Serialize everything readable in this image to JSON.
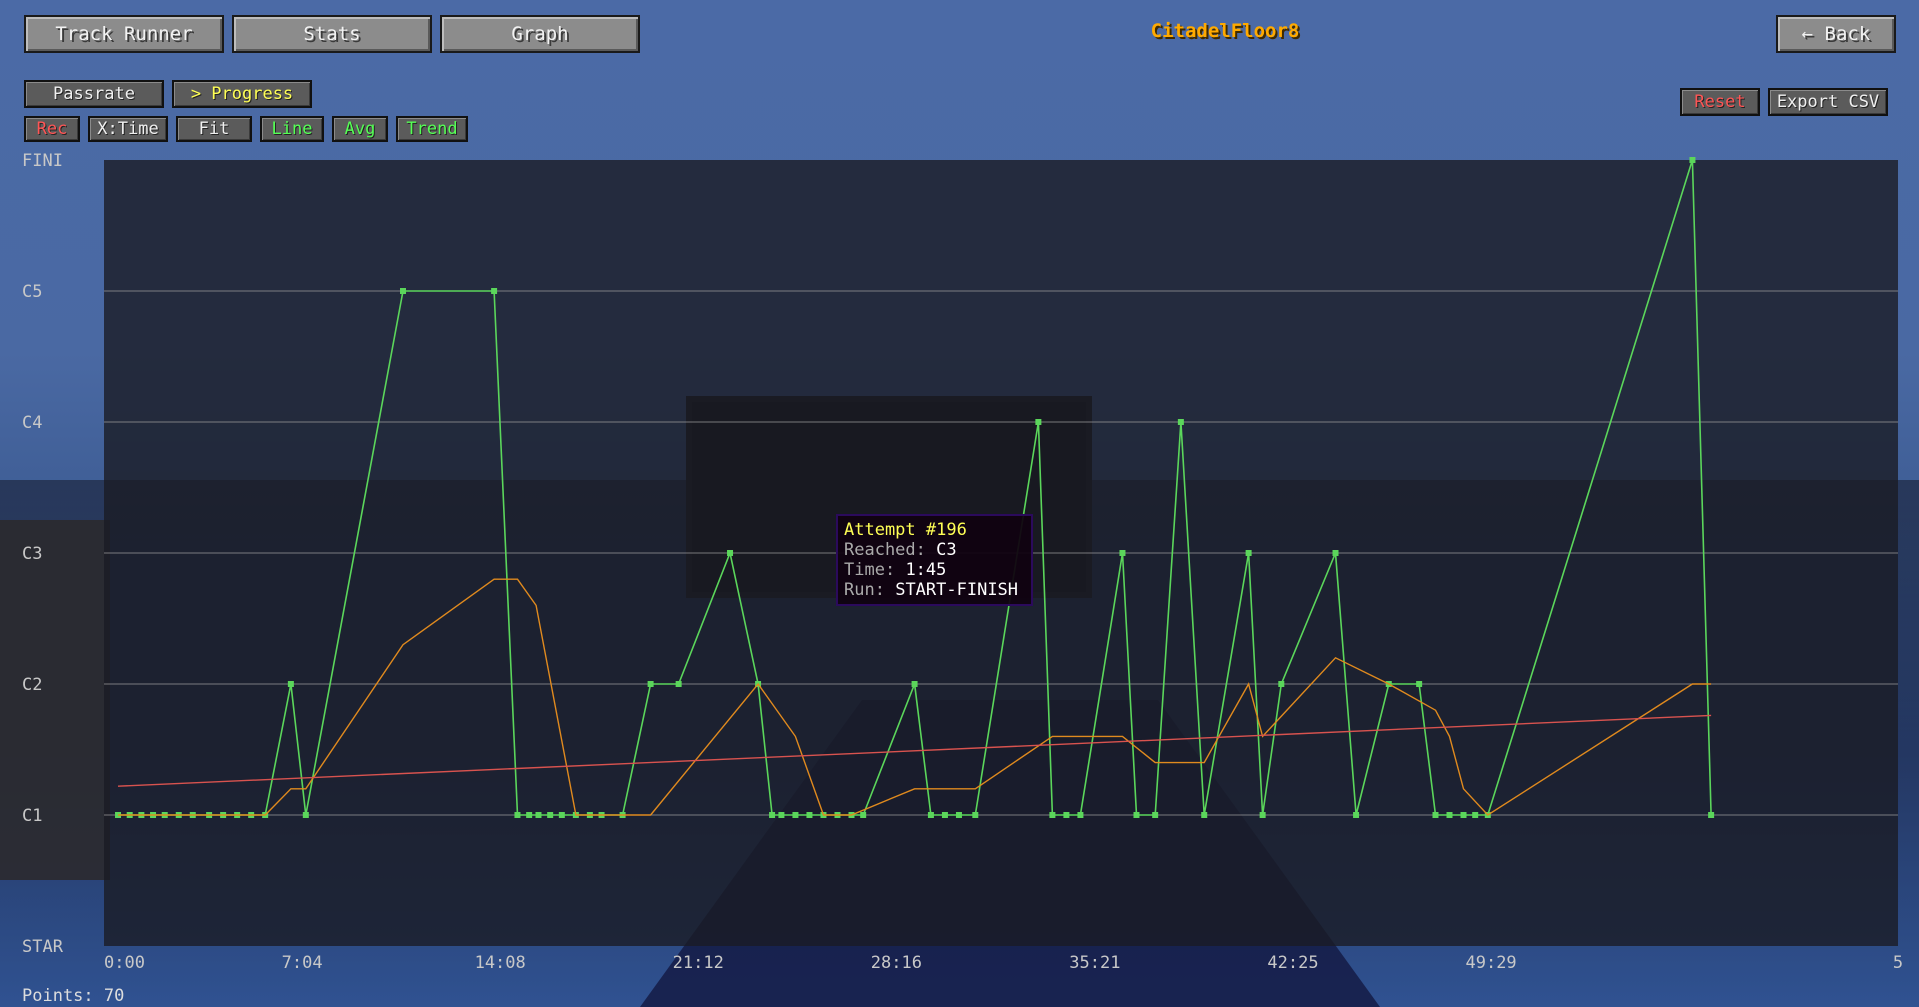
{
  "header": {
    "tabs": [
      {
        "label": "Track Runner"
      },
      {
        "label": "Stats"
      },
      {
        "label": "Graph"
      }
    ],
    "title": "CitadelFloor8",
    "back_label": "← Back"
  },
  "view_toggles": {
    "passrate": "Passrate",
    "progress": "> Progress"
  },
  "options": {
    "rec": "Rec",
    "xtime": "X:Time",
    "fit": "Fit",
    "line": "Line",
    "avg": "Avg",
    "trend": "Trend"
  },
  "actions": {
    "reset": "Reset",
    "export": "Export CSV"
  },
  "tooltip": {
    "title": "Attempt #196",
    "reached_label": "Reached:",
    "reached_value": "C3",
    "time_label": "Time:",
    "time_value": "1:45",
    "run_label": "Run:",
    "run_value": "START-FINISH"
  },
  "footer": {
    "points_label": "Points:",
    "points_value": "70"
  },
  "colors": {
    "line": "#5bd65b",
    "avg": "#e08a1e",
    "trend": "#d9534f",
    "gridline": "#9a9a9a",
    "title": "#ffaa00"
  },
  "chart_data": {
    "type": "line",
    "xlabel": "",
    "ylabel": "",
    "x_unit": "seconds",
    "xlim": [
      0,
      3840
    ],
    "y_categories": [
      "STAR",
      "C1",
      "C2",
      "C3",
      "C4",
      "C5",
      "FINI"
    ],
    "x_tick_labels": [
      "0:00",
      "7:04",
      "14:08",
      "21:12",
      "28:16",
      "35:21",
      "42:25",
      "49:29",
      "5"
    ],
    "x_tick_values": [
      0,
      424,
      848,
      1272,
      1696,
      2121,
      2545,
      2969,
      3840
    ],
    "grid": true,
    "series": [
      {
        "name": "Line",
        "values": [
          [
            30,
            1
          ],
          [
            55,
            1
          ],
          [
            80,
            1
          ],
          [
            105,
            1
          ],
          [
            130,
            1
          ],
          [
            160,
            1
          ],
          [
            190,
            1
          ],
          [
            225,
            1
          ],
          [
            255,
            1
          ],
          [
            285,
            1
          ],
          [
            315,
            1
          ],
          [
            345,
            1
          ],
          [
            400,
            2
          ],
          [
            432,
            1
          ],
          [
            640,
            5
          ],
          [
            835,
            5
          ],
          [
            885,
            1
          ],
          [
            910,
            1
          ],
          [
            930,
            1
          ],
          [
            955,
            1
          ],
          [
            980,
            1
          ],
          [
            1010,
            1
          ],
          [
            1040,
            1
          ],
          [
            1065,
            1
          ],
          [
            1110,
            1
          ],
          [
            1170,
            2
          ],
          [
            1230,
            2
          ],
          [
            1340,
            3
          ],
          [
            1400,
            2
          ],
          [
            1430,
            1
          ],
          [
            1450,
            1
          ],
          [
            1480,
            1
          ],
          [
            1510,
            1
          ],
          [
            1540,
            1
          ],
          [
            1570,
            1
          ],
          [
            1600,
            1
          ],
          [
            1625,
            1
          ],
          [
            1735,
            2
          ],
          [
            1770,
            1
          ],
          [
            1800,
            1
          ],
          [
            1830,
            1
          ],
          [
            1865,
            1
          ],
          [
            2000,
            4
          ],
          [
            2030,
            1
          ],
          [
            2060,
            1
          ],
          [
            2090,
            1
          ],
          [
            2180,
            3
          ],
          [
            2210,
            1
          ],
          [
            2250,
            1
          ],
          [
            2305,
            4
          ],
          [
            2355,
            1
          ],
          [
            2450,
            3
          ],
          [
            2480,
            1
          ],
          [
            2520,
            2
          ],
          [
            2636,
            3
          ],
          [
            2680,
            1
          ],
          [
            2750,
            2
          ],
          [
            2815,
            2
          ],
          [
            2850,
            1
          ],
          [
            2880,
            1
          ],
          [
            2910,
            1
          ],
          [
            2935,
            1
          ],
          [
            2962,
            1
          ],
          [
            3400,
            6
          ],
          [
            3440,
            1
          ]
        ]
      },
      {
        "name": "Avg",
        "values": [
          [
            30,
            1
          ],
          [
            345,
            1
          ],
          [
            400,
            1.2
          ],
          [
            432,
            1.2
          ],
          [
            640,
            2.3
          ],
          [
            835,
            2.8
          ],
          [
            885,
            2.8
          ],
          [
            925,
            2.6
          ],
          [
            1010,
            1
          ],
          [
            1170,
            1
          ],
          [
            1400,
            2
          ],
          [
            1480,
            1.6
          ],
          [
            1540,
            1
          ],
          [
            1600,
            1
          ],
          [
            1735,
            1.2
          ],
          [
            1865,
            1.2
          ],
          [
            2030,
            1.6
          ],
          [
            2180,
            1.6
          ],
          [
            2250,
            1.4
          ],
          [
            2355,
            1.4
          ],
          [
            2450,
            2
          ],
          [
            2480,
            1.6
          ],
          [
            2636,
            2.2
          ],
          [
            2750,
            2
          ],
          [
            2850,
            1.8
          ],
          [
            2880,
            1.6
          ],
          [
            2910,
            1.2
          ],
          [
            2962,
            1
          ],
          [
            3400,
            2
          ],
          [
            3440,
            2
          ]
        ]
      },
      {
        "name": "Trend",
        "values": [
          [
            30,
            1.22
          ],
          [
            3440,
            1.76
          ]
        ]
      }
    ],
    "highlight": {
      "x": 1400,
      "y": 3
    }
  }
}
